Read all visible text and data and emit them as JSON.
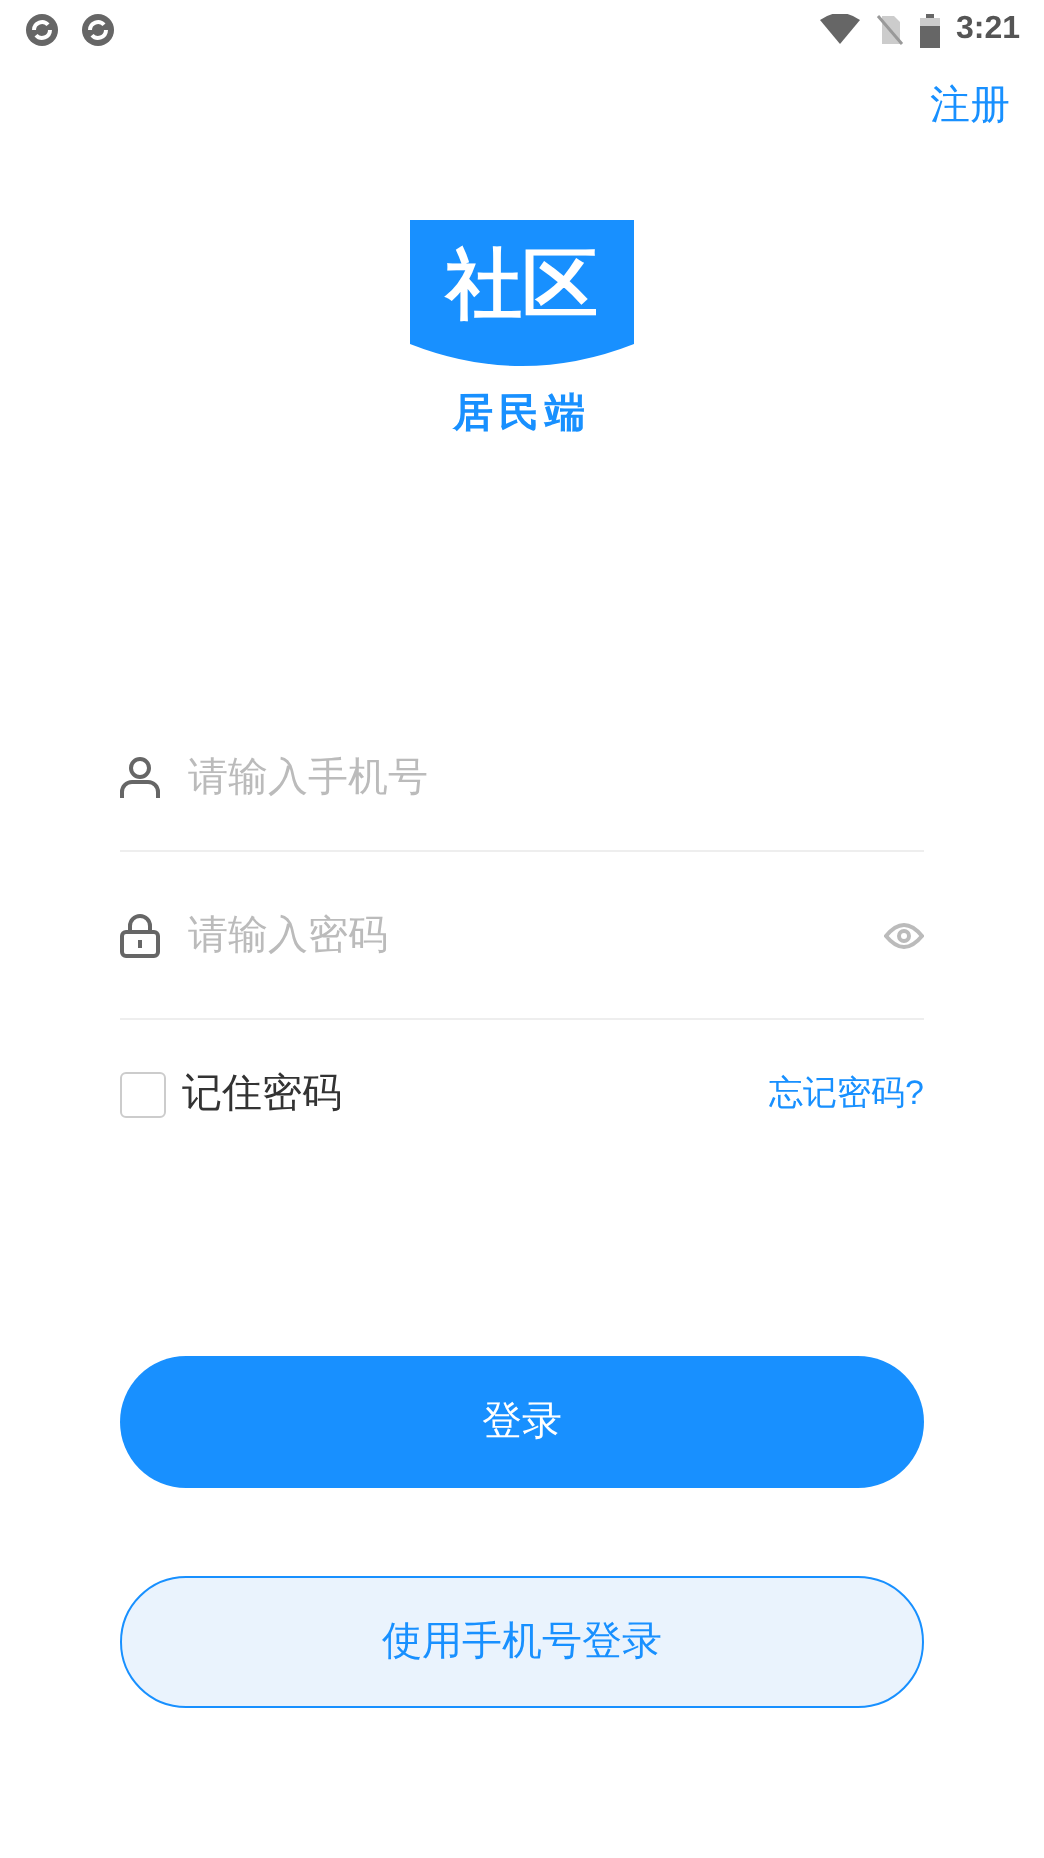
{
  "status_bar": {
    "time": "3:21"
  },
  "register_link": "注册",
  "logo": {
    "title": "社区",
    "subtitle": "居民端"
  },
  "phone_field": {
    "placeholder": "请输入手机号"
  },
  "password_field": {
    "placeholder": "请输入密码"
  },
  "remember": {
    "label": "记住密码",
    "checked": false
  },
  "forgot_link": "忘记密码?",
  "login_button": "登录",
  "phone_login_button": "使用手机号登录"
}
